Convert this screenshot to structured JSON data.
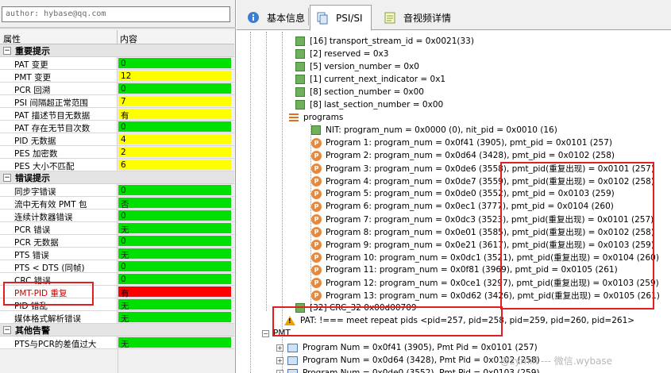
{
  "left_panel": {
    "author": "author: hybase@qq.com",
    "columns": {
      "name": "属性",
      "value": "内容"
    },
    "groups": [
      {
        "title": "重要提示",
        "rows": [
          {
            "name": "PAT 变更",
            "value": "0",
            "color": "green"
          },
          {
            "name": "PMT 变更",
            "value": "12",
            "color": "yellow"
          },
          {
            "name": "PCR 回溯",
            "value": "0",
            "color": "green"
          },
          {
            "name": "PSI 间隔超正常范围",
            "value": "7",
            "color": "yellow"
          },
          {
            "name": "PAT 描述节目无数据",
            "value": "有",
            "color": "yellow"
          },
          {
            "name": "PAT 存在无节目次数",
            "value": "0",
            "color": "green"
          },
          {
            "name": "PID 无数据",
            "value": "4",
            "color": "yellow"
          },
          {
            "name": "PES 加密数",
            "value": "2",
            "color": "yellow"
          },
          {
            "name": "PES 大小不匹配",
            "value": "6",
            "color": "yellow"
          }
        ]
      },
      {
        "title": "错误提示",
        "rows": [
          {
            "name": "同步字错误",
            "value": "0",
            "color": "green"
          },
          {
            "name": "流中无有效 PMT 包",
            "value": "否",
            "color": "green"
          },
          {
            "name": "连续计数器错误",
            "value": "0",
            "color": "green"
          },
          {
            "name": "PCR 错误",
            "value": "无",
            "color": "green"
          },
          {
            "name": "PCR 无数据",
            "value": "0",
            "color": "green"
          },
          {
            "name": "PTS 错误",
            "value": "无",
            "color": "green"
          },
          {
            "name": "PTS < DTS (同帧)",
            "value": "0",
            "color": "green"
          },
          {
            "name": "CRC 错误",
            "value": "0",
            "color": "green"
          },
          {
            "name": "PMT-PID 重复",
            "value": "有",
            "color": "red",
            "name_red": true
          },
          {
            "name": "PID 错乱",
            "value": "无",
            "color": "green"
          },
          {
            "name": "媒体格式解析错误",
            "value": "无",
            "color": "green"
          }
        ]
      },
      {
        "title": "其他告警",
        "rows": [
          {
            "name": "PTS与PCR的差值过大",
            "value": "无",
            "color": "green"
          }
        ]
      }
    ]
  },
  "tabs": [
    {
      "label": "基本信息",
      "icon": "info-icon",
      "active": false
    },
    {
      "label": "PSI/SI",
      "icon": "tree-doc-icon",
      "active": true
    },
    {
      "label": "音视频详情",
      "icon": "notepad-icon",
      "active": false
    }
  ],
  "tree": {
    "pat_fields": [
      "[16] transport_stream_id = 0x0021(33)",
      "[2] reserved = 0x3",
      "[5] version_number = 0x0",
      "[1] current_next_indicator = 0x1",
      "[8] section_number = 0x00",
      "[8] last_section_number = 0x00"
    ],
    "programs_label": "programs",
    "nit": "NIT: program_num = 0x0000 (0), nit_pid = 0x0010 (16)",
    "programs": [
      "Program 1: program_num = 0x0f41 (3905), pmt_pid = 0x0101 (257)",
      "Program 2: program_num = 0x0d64 (3428), pmt_pid = 0x0102 (258)",
      "Program 3: program_num = 0x0de6 (3558), pmt_pid(重复出现) = 0x0101 (257)",
      "Program 4: program_num = 0x0de7 (3559), pmt_pid(重复出现) = 0x0102 (258)",
      "Program 5: program_num = 0x0de0 (3552), pmt_pid = 0x0103 (259)",
      "Program 6: program_num = 0x0ec1 (3777), pmt_pid = 0x0104 (260)",
      "Program 7: program_num = 0x0dc3 (3523), pmt_pid(重复出现) = 0x0101 (257)",
      "Program 8: program_num = 0x0e01 (3585), pmt_pid(重复出现) = 0x0102 (258)",
      "Program 9: program_num = 0x0e21 (3617), pmt_pid(重复出现) = 0x0103 (259)",
      "Program 10: program_num = 0x0dc1 (3521), pmt_pid(重复出现) = 0x0104 (260)",
      "Program 11: program_num = 0x0f81 (3969), pmt_pid = 0x0105 (261)",
      "Program 12: program_num = 0x0ce1 (3297), pmt_pid(重复出现) = 0x0103 (259)",
      "Program 13: program_num = 0x0d62 (3426), pmt_pid(重复出现) = 0x0105 (261)"
    ],
    "crc": "[32] CRC_32 0x00d00709",
    "pat_warning": "PAT: !=== meet repeat pids <pid=257, pid=258, pid=259, pid=260, pid=261>",
    "pmt_label": "PMT",
    "pmt_items": [
      "Program Num = 0x0f41 (3905), Pmt Pid = 0x0101 (257)",
      "Program Num = 0x0d64 (3428), Pmt Pid = 0x0102 (258)",
      "Program Num = 0x0de0 (3552), Pmt Pid = 0x0103 (259)"
    ]
  },
  "watermark": "@zymill --- 微信.wybase",
  "colors": {
    "green": "#00e000",
    "yellow": "#ffff00",
    "red": "#ff0000",
    "annotation": "#e02020"
  }
}
